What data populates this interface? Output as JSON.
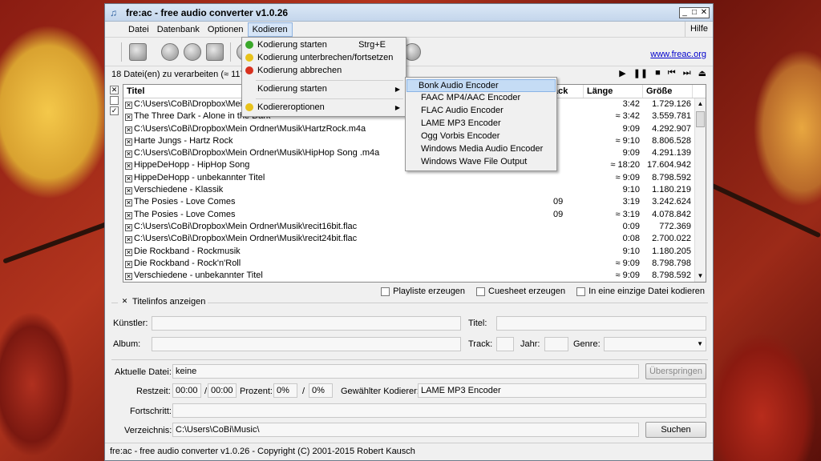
{
  "window": {
    "title": "fre:ac - free audio converter v1.0.26"
  },
  "menubar": {
    "items": [
      "Datei",
      "Datenbank",
      "Optionen",
      "Kodieren"
    ],
    "help": "Hilfe"
  },
  "toolbar": {
    "link": "www.freac.org"
  },
  "status": {
    "files_text": "18 Datei(en) zu verarbeiten (≈ 117:"
  },
  "list": {
    "headers": {
      "title": "Titel",
      "track": "ack",
      "length": "Länge",
      "size": "Größe"
    },
    "rows": [
      {
        "title": "C:\\Users\\CoBi\\Dropbox\\Mein",
        "track": "",
        "length": "3:42",
        "size": "1.729.126"
      },
      {
        "title": "The Three Dark - Alone in the Dark",
        "track": "",
        "length": "≈ 3:42",
        "size": "3.559.781"
      },
      {
        "title": "C:\\Users\\CoBi\\Dropbox\\Mein Ordner\\Musik\\HartzRock.m4a",
        "track": "",
        "length": "9:09",
        "size": "4.292.907"
      },
      {
        "title": "Harte Jungs - Hartz Rock",
        "track": "",
        "length": "≈ 9:10",
        "size": "8.806.528"
      },
      {
        "title": "C:\\Users\\CoBi\\Dropbox\\Mein Ordner\\Musik\\HipHop Song .m4a",
        "track": "",
        "length": "9:09",
        "size": "4.291.139"
      },
      {
        "title": "HippeDeHopp - HipHop Song",
        "track": "",
        "length": "≈ 18:20",
        "size": "17.604.942"
      },
      {
        "title": "HippeDeHopp - unbekannter Titel",
        "track": "",
        "length": "≈ 9:09",
        "size": "8.798.592"
      },
      {
        "title": "Verschiedene - Klassik",
        "track": "",
        "length": "9:10",
        "size": "1.180.219"
      },
      {
        "title": "The Posies - Love Comes",
        "track": "09",
        "length": "3:19",
        "size": "3.242.624"
      },
      {
        "title": "The Posies - Love Comes",
        "track": "09",
        "length": "≈ 3:19",
        "size": "4.078.842"
      },
      {
        "title": "C:\\Users\\CoBi\\Dropbox\\Mein Ordner\\Musik\\recit16bit.flac",
        "track": "",
        "length": "0:09",
        "size": "772.369"
      },
      {
        "title": "C:\\Users\\CoBi\\Dropbox\\Mein Ordner\\Musik\\recit24bit.flac",
        "track": "",
        "length": "0:08",
        "size": "2.700.022"
      },
      {
        "title": "Die Rockband - Rockmusik",
        "track": "",
        "length": "9:10",
        "size": "1.180.205"
      },
      {
        "title": "Die Rockband - Rock'n'Roll",
        "track": "",
        "length": "≈ 9:09",
        "size": "8.798.798"
      },
      {
        "title": "Verschiedene - unbekannter Titel",
        "track": "",
        "length": "≈ 9:09",
        "size": "8.798.592"
      }
    ]
  },
  "options": {
    "playlist": "Playliste erzeugen",
    "cuesheet": "Cuesheet erzeugen",
    "single_file": "In eine einzige Datei kodieren"
  },
  "titleinfo": {
    "legend": "Titelinfos anzeigen",
    "artist": "Künstler:",
    "title": "Titel:",
    "album": "Album:",
    "track": "Track:",
    "year": "Jahr:",
    "genre": "Genre:"
  },
  "progress": {
    "current_file_label": "Aktuelle Datei:",
    "current_file": "keine",
    "skip": "Überspringen",
    "remaining_label": "Restzeit:",
    "remaining": "00:00",
    "slash1": "/",
    "total": "00:00",
    "percent_label": "Prozent:",
    "percent": "0%",
    "slash2": "/",
    "percent_total": "0%",
    "encoder_label": "Gewählter Kodierer:",
    "encoder": "LAME MP3 Encoder",
    "progress_label": "Fortschritt:",
    "progress_value": 0,
    "dir_label": "Verzeichnis:",
    "dir": "C:\\Users\\CoBi\\Music\\",
    "browse": "Suchen"
  },
  "statusbar": {
    "text": "fre:ac - free audio converter v1.0.26 - Copyright (C) 2001-2015 Robert Kausch"
  },
  "kodieren_menu": {
    "start": "Kodierung starten",
    "start_shortcut": "Strg+E",
    "pause": "Kodierung unterbrechen/fortsetzen",
    "abort": "Kodierung abbrechen",
    "start_with": "Kodierung starten",
    "encoder_options": "Kodiereroptionen"
  },
  "encoder_submenu": [
    "Bonk Audio Encoder",
    "FAAC MP4/AAC Encoder",
    "FLAC Audio Encoder",
    "LAME MP3 Encoder",
    "Ogg Vorbis Encoder",
    "Windows Media Audio Encoder",
    "Windows Wave File Output"
  ],
  "colors": {
    "accent": "#0078d7",
    "start_dot": "#3aa82a",
    "pause_dot": "#e8c21a",
    "abort_dot": "#d8301e"
  }
}
